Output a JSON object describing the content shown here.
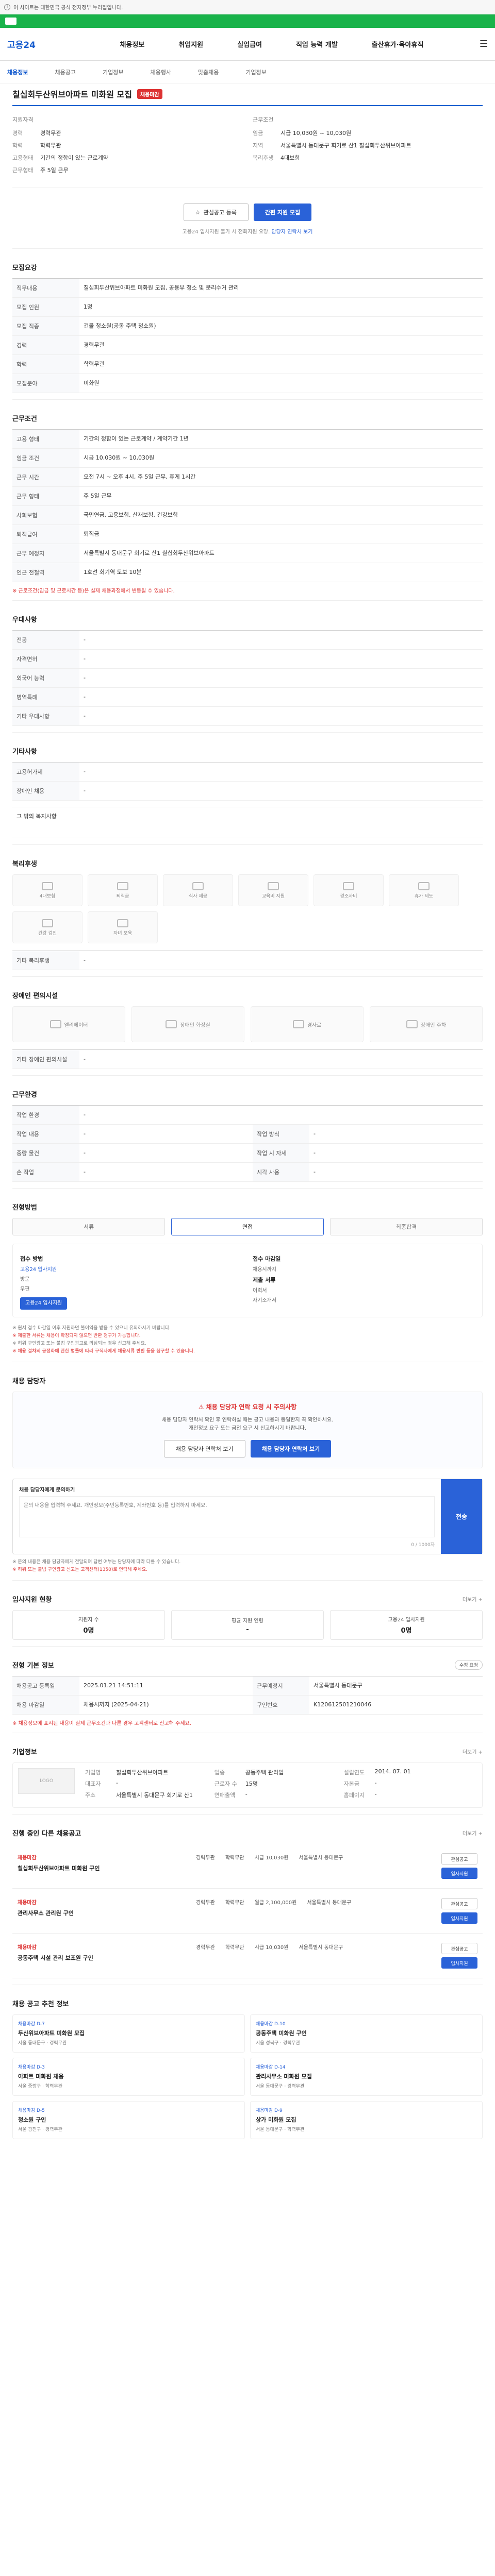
{
  "topbar": {
    "text": "이 사이트는 대한민국 공식 전자정부 누리집입니다."
  },
  "header": {
    "brand": "고용24",
    "nav": [
      "채용정보",
      "취업지원",
      "실업급여",
      "직업 능력 개발",
      "출산휴가·육아휴직"
    ]
  },
  "subnav": {
    "items": [
      "채용정보",
      "채용공고",
      "기업정보",
      "채용행사",
      "맞춤채용",
      "기업정보"
    ]
  },
  "job": {
    "title": "칠십회두산위브아파트 미화원 모집",
    "status_badge": "채용마감",
    "left_head": "지원자격",
    "right_head": "근무조건",
    "left": [
      {
        "k": "경력",
        "v": "경력무관"
      },
      {
        "k": "학력",
        "v": "학력무관"
      },
      {
        "k": "고용형태",
        "v": "기간의 정함이 있는 근로계약"
      },
      {
        "k": "근무형태",
        "v": "주 5일 근무"
      }
    ],
    "right": [
      {
        "k": "임금",
        "v": "시급 10,030원 ~ 10,030원"
      },
      {
        "k": "지역",
        "v": "서울특별시 동대문구 회기로 산1  칠십회두산위브아파트"
      },
      {
        "k": "복리후생",
        "v": "4대보험"
      }
    ]
  },
  "cta": {
    "scrap": "관심공고 등록",
    "apply": "간편 지원 모집",
    "note": "고용24 입사지원 불가 시 전화지원 요망.",
    "note_link": "담당자 연락처 보기"
  },
  "recruit": {
    "title": "모집요강",
    "rows": [
      {
        "th": "직무내용",
        "td": "칠십회두산위브아파트 미화원 모집, 공용부 청소 및 분리수거 관리"
      },
      {
        "th": "모집 인원",
        "td": "1명"
      },
      {
        "th": "모집 직종",
        "td": "건물 청소원(공동 주택 청소원)"
      },
      {
        "th": "경력",
        "td": "경력무관"
      },
      {
        "th": "학력",
        "td": "학력무관"
      },
      {
        "th": "모집분야",
        "td": "미화원"
      }
    ]
  },
  "conditions": {
    "title": "근무조건",
    "rows": [
      {
        "th": "고용 형태",
        "td": "기간의 정함이 있는 근로계약 / 계약기간 1년"
      },
      {
        "th": "임금 조건",
        "td": "시급 10,030원 ~ 10,030원"
      },
      {
        "th": "근무 시간",
        "td": "오전 7시 ~ 오후 4시, 주 5일 근무, 휴게 1시간"
      },
      {
        "th": "근무 형태",
        "td": "주 5일 근무"
      },
      {
        "th": "사회보험",
        "td": "국민연금, 고용보험, 산재보험, 건강보험"
      },
      {
        "th": "퇴직급여",
        "td": "퇴직금"
      },
      {
        "th": "근무 예정지",
        "td": "서울특별시 동대문구 회기로 산1  칠십회두산위브아파트"
      },
      {
        "th": "인근 전철역",
        "td": "1호선 회기역 도보 10분"
      }
    ],
    "note": "※ 근로조건(임금 및 근로시간 등)은 실제 채용과정에서 변동될 수 있습니다."
  },
  "preference": {
    "title": "우대사항",
    "rows": [
      {
        "th": "전공",
        "td": "-"
      },
      {
        "th": "자격면허",
        "td": "-"
      },
      {
        "th": "외국어 능력",
        "td": "-"
      },
      {
        "th": "병역특례",
        "td": "-"
      },
      {
        "th": "기타 우대사항",
        "td": "-"
      }
    ]
  },
  "other": {
    "title": "기타사항",
    "rows": [
      {
        "th": "고용허가제",
        "td": "-"
      },
      {
        "th": "장애인 채용",
        "td": "-"
      }
    ],
    "extra": "그 밖의 복지사항"
  },
  "welfare": {
    "title": "복리후생",
    "items": [
      "4대보험",
      "퇴직금",
      "식사 제공",
      "교육비 지원",
      "경조사비",
      "휴가 제도",
      "건강 검진",
      "자녀 보육"
    ],
    "extra_label": "기타 복리후생"
  },
  "disability": {
    "title": "장애인 편의시설",
    "items": [
      "엘리베이터",
      "장애인 화장실",
      "경사로",
      "장애인 주차"
    ],
    "extra_label": "기타 장애인 편의시설"
  },
  "worker": {
    "title": "근무환경",
    "rows": [
      {
        "th": "작업 환경",
        "td": "-",
        "th2": "",
        "td2": ""
      },
      {
        "th": "작업 내용",
        "td": "-",
        "th2": "작업 방식",
        "td2": "-"
      },
      {
        "th": "중량 물건",
        "td": "-",
        "th2": "작업 시 자세",
        "td2": "-"
      },
      {
        "th": "손 작업",
        "td": "-",
        "th2": "시각 사용",
        "td2": "-"
      }
    ]
  },
  "process": {
    "title": "전형방법",
    "steps": [
      "서류",
      "면접",
      "최종합격"
    ],
    "apply_head": "접수 방법",
    "apply_lines": [
      "고용24 입사지원",
      "방문",
      "우편"
    ],
    "deadline_head": "접수 마감일",
    "deadline": "채용시까지",
    "docs_head": "제출 서류",
    "docs": [
      "이력서",
      "자기소개서"
    ],
    "apply_button": "고용24 입사지원",
    "bullets": [
      "※ 원서 접수 마감일 이후 지원하면 불이익을 받을 수 있으니 유의하시기 바랍니다.",
      "※ 제출한 서류는 채용이 확정되지 않으면 반환 청구가 가능합니다.",
      "※ 허위 구인광고 또는 불법 구인광고로 의심되는 경우 신고해 주세요.",
      "※ 채용 절차의 공정화에 관한 법률에 따라 구직자에게 채용서류 반환 등을 청구할 수 있습니다."
    ]
  },
  "safety": {
    "title": "채용 담당자",
    "warn": "채용 담당자 연락 요청 시 주의사항",
    "lines": [
      "채용 담당자 연락처 확인 후 연락하실 때는 공고 내용과 동일한지 꼭 확인하세요.",
      "개인정보 요구 또는 금전 요구 시 신고하시기 바랍니다."
    ],
    "btn1": "채용 담당자 연락처 보기",
    "btn2": "채용 담당자 연락처 보기"
  },
  "report": {
    "label": "채용 담당자에게 문의하기",
    "placeholder": "문의 내용을 입력해 주세요. 개인정보(주민등록번호, 계좌번호 등)를 입력하지 마세요.",
    "count": "0 / 1000자",
    "submit": "전송",
    "notes": [
      "※ 문의 내용은 채용 담당자에게 전달되며 답변 여부는 담당자에 따라 다를 수 있습니다.",
      "※ 허위 또는 불법 구인광고 신고는 고객센터(1350)로 연락해 주세요."
    ]
  },
  "stats": {
    "title": "입사지원 현황",
    "more": "더보기 +",
    "items": [
      {
        "label": "지원자 수",
        "val": "0명"
      },
      {
        "label": "평균 지원 연령",
        "val": "-"
      },
      {
        "label": "고용24 입사지원",
        "val": "0명"
      }
    ]
  },
  "manage": {
    "title": "전형 기본 정보",
    "pill": "수정 요청",
    "rows": [
      {
        "th": "채용공고 등록일",
        "td": "2025.01.21 14:51:11",
        "th2": "근무예정지",
        "td2": "서울특별시 동대문구"
      },
      {
        "th": "채용 마감일",
        "td": "채용시까지 (2025-04-21)",
        "th2": "구인번호",
        "td2": "K120612501210046"
      }
    ],
    "note": "※ 채용정보에 표시된 내용이 실제 근무조건과 다른 경우 고객센터로 신고해 주세요."
  },
  "company": {
    "title": "기업정보",
    "more": "더보기 +",
    "logo": "LOGO",
    "fields": [
      {
        "k": "기업명",
        "v": "칠십회두산위브아파트"
      },
      {
        "k": "업종",
        "v": "공동주택 관리업"
      },
      {
        "k": "설립연도",
        "v": "2014. 07. 01"
      },
      {
        "k": "대표자",
        "v": "-"
      },
      {
        "k": "근로자 수",
        "v": "15명"
      },
      {
        "k": "자본금",
        "v": "-"
      },
      {
        "k": "주소",
        "v": "서울특별시 동대문구 회기로 산1"
      },
      {
        "k": "연매출액",
        "v": "-"
      },
      {
        "k": "홈페이지",
        "v": "-"
      }
    ]
  },
  "other_jobs": {
    "title": "진행 중인 다른 채용공고",
    "more": "더보기 +",
    "items": [
      {
        "cname": "채용마감",
        "title": "칠십회두산위브아파트 미화원 구인",
        "meta": [
          "경력무관",
          "학력무관",
          "시급 10,030원",
          "서울특별시 동대문구"
        ]
      },
      {
        "cname": "채용마감",
        "title": "관리사무소 관리원 구인",
        "meta": [
          "경력무관",
          "학력무관",
          "월급 2,100,000원",
          "서울특별시 동대문구"
        ]
      },
      {
        "cname": "채용마감",
        "title": "공동주택 시설 관리 보조원 구인",
        "meta": [
          "경력무관",
          "학력무관",
          "시급 10,030원",
          "서울특별시 동대문구"
        ]
      }
    ],
    "btn1": "관심공고",
    "btn2": "입사지원"
  },
  "recommend": {
    "title": "채용 공고 추천 정보",
    "items": [
      {
        "top": "채용마감 D-7",
        "title": "두산위브아파트 미화원 모집",
        "sub": "서울 동대문구 · 경력무관"
      },
      {
        "top": "채용마감 D-10",
        "title": "공동주택 미화원 구인",
        "sub": "서울 성북구 · 경력무관"
      },
      {
        "top": "채용마감 D-3",
        "title": "아파트 미화원 채용",
        "sub": "서울 중랑구 · 학력무관"
      },
      {
        "top": "채용마감 D-14",
        "title": "관리사무소 미화원 모집",
        "sub": "서울 동대문구 · 경력무관"
      },
      {
        "top": "채용마감 D-5",
        "title": "청소원 구인",
        "sub": "서울 광진구 · 경력무관"
      },
      {
        "top": "채용마감 D-9",
        "title": "상가 미화원 모집",
        "sub": "서울 동대문구 · 학력무관"
      }
    ]
  },
  "colors": {
    "brand_green": "#19b34a",
    "brand_blue": "#2a62d8",
    "alert_red": "#d33333"
  }
}
